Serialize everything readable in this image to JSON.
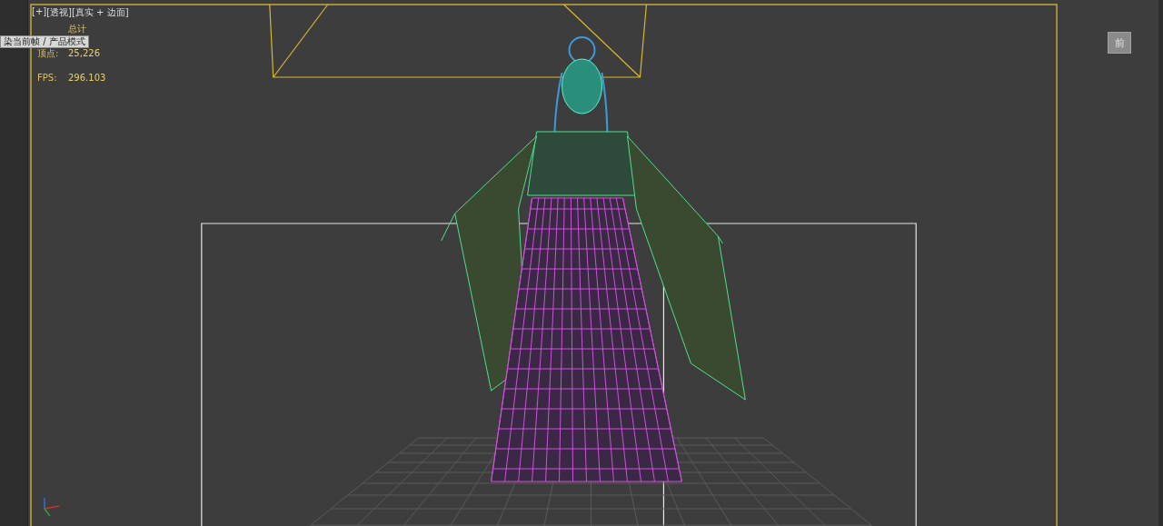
{
  "viewport": {
    "menu_labels": [
      "[+]",
      "[透视]",
      "[真实 + 边面]"
    ],
    "stats": {
      "title": "总计",
      "rows": [
        {
          "label": "顶点:",
          "value": "25,226"
        },
        {
          "label": "FPS:",
          "value": "296.103"
        }
      ]
    },
    "tooltip": "染当前帧 / 产品模式",
    "viewcube": {
      "face": "前"
    }
  }
}
